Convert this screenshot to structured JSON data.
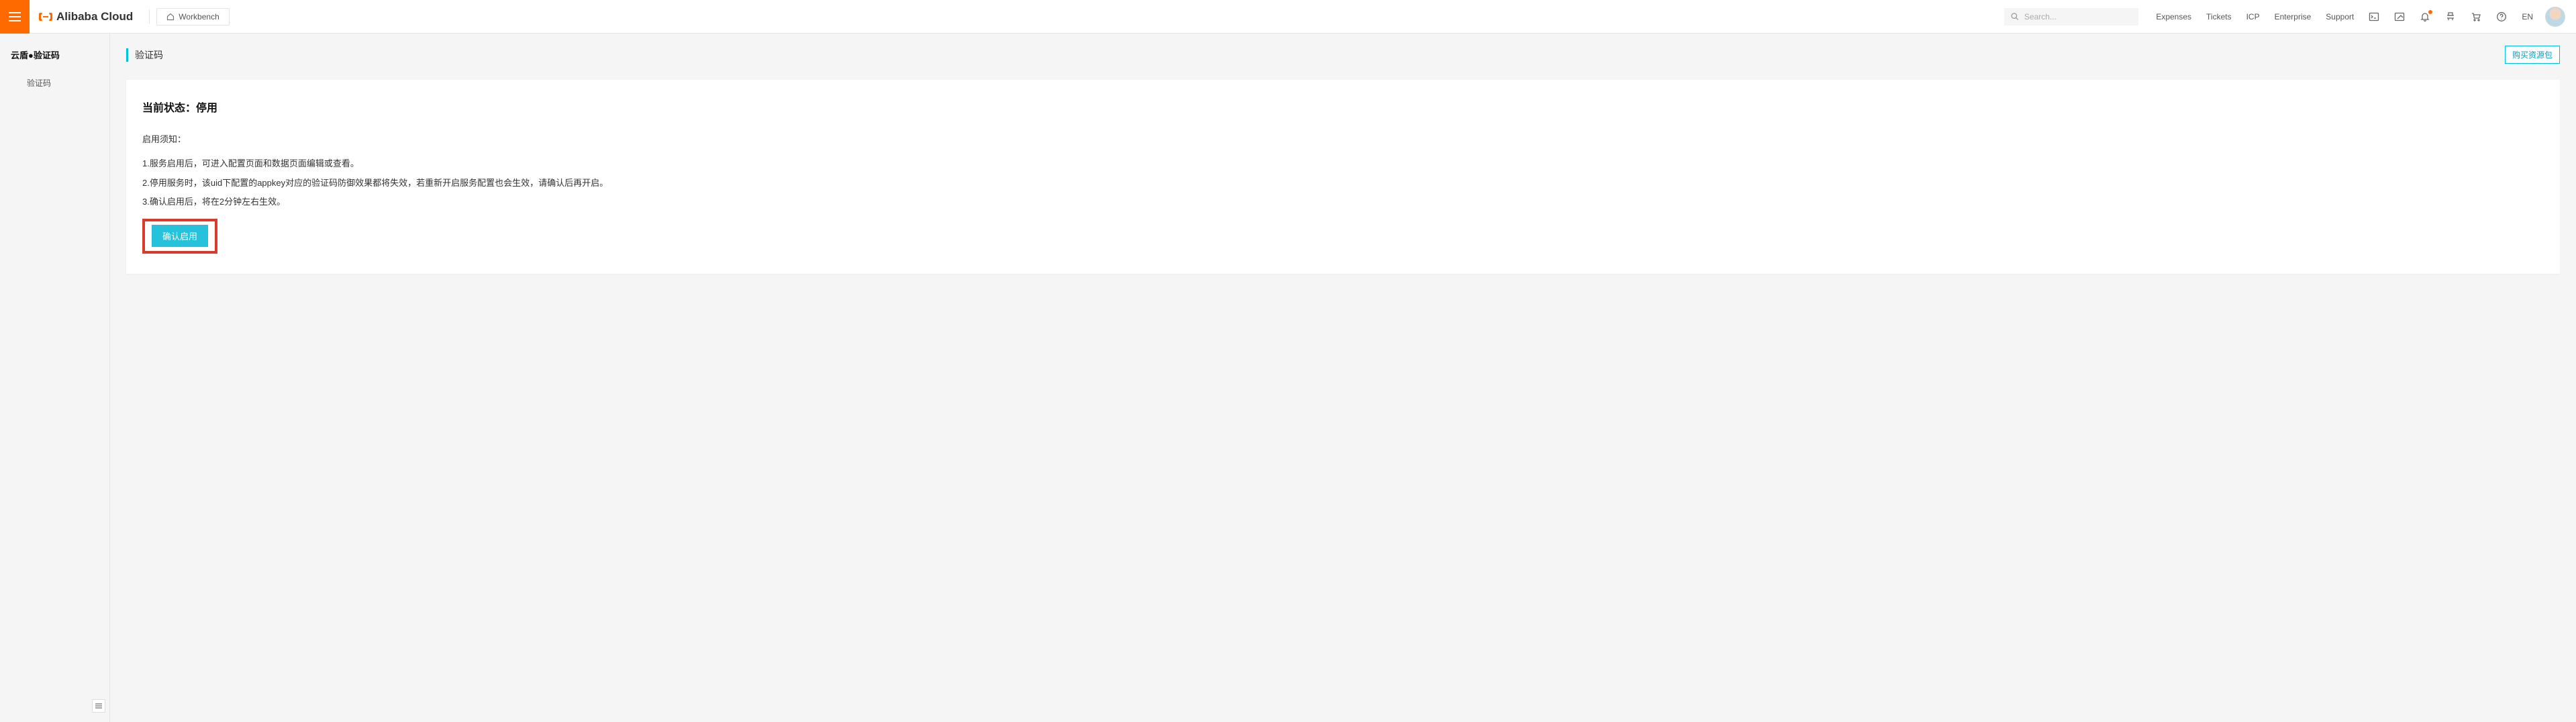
{
  "header": {
    "brand": "Alibaba Cloud",
    "workbench": "Workbench",
    "search_placeholder": "Search...",
    "nav": {
      "expenses": "Expenses",
      "tickets": "Tickets",
      "icp": "ICP",
      "enterprise": "Enterprise",
      "support": "Support"
    },
    "lang": "EN"
  },
  "sidebar": {
    "title": "云盾●验证码",
    "items": [
      {
        "label": "验证码"
      }
    ]
  },
  "page": {
    "title": "验证码",
    "buy_button": "购买资源包",
    "status_label": "当前状态：",
    "status_value": "停用",
    "notice_heading": "启用须知：",
    "notices": [
      "1.服务启用后，可进入配置页面和数据页面编辑或查看。",
      "2.停用服务时，该uid下配置的appkey对应的验证码防御效果都将失效，若重新开启服务配置也会生效，请确认后再开启。",
      "3.确认启用后，将在2分钟左右生效。"
    ],
    "confirm_button": "确认启用"
  }
}
